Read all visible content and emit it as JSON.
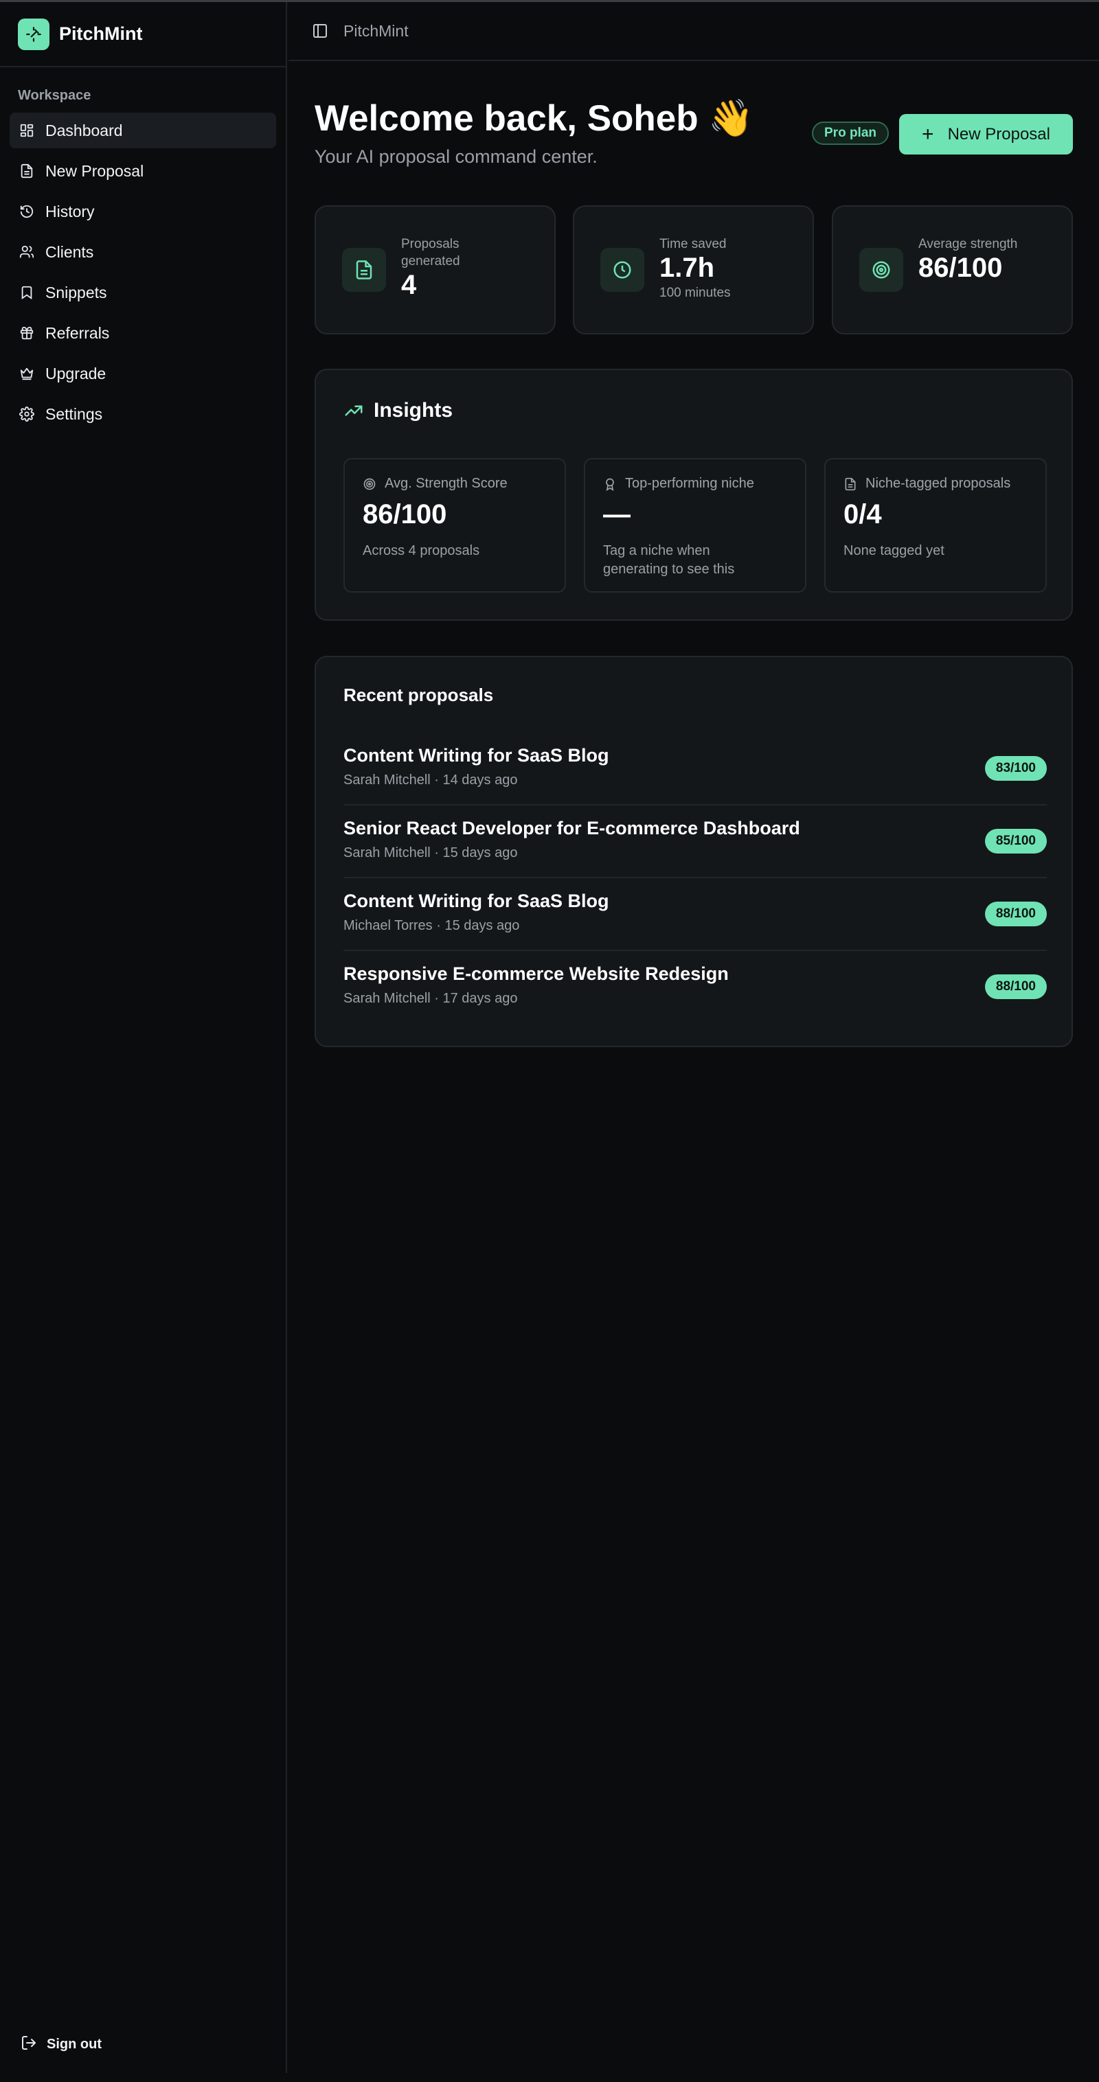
{
  "brand": {
    "name": "PitchMint"
  },
  "sidebar": {
    "section_label": "Workspace",
    "items": [
      {
        "label": "Dashboard",
        "icon": "dashboard-icon",
        "active": true
      },
      {
        "label": "New Proposal",
        "icon": "file-icon"
      },
      {
        "label": "History",
        "icon": "history-icon"
      },
      {
        "label": "Clients",
        "icon": "users-icon"
      },
      {
        "label": "Snippets",
        "icon": "bookmark-icon"
      },
      {
        "label": "Referrals",
        "icon": "gift-icon"
      },
      {
        "label": "Upgrade",
        "icon": "crown-icon"
      },
      {
        "label": "Settings",
        "icon": "gear-icon"
      }
    ],
    "sign_out": "Sign out"
  },
  "topbar": {
    "title": "PitchMint"
  },
  "header": {
    "welcome": "Welcome back, Soheb 👋",
    "subtitle": "Your AI proposal command center.",
    "plan_badge": "Pro plan",
    "new_proposal_button": "New Proposal"
  },
  "stats": [
    {
      "label": "Proposals generated",
      "value": "4",
      "sub": "",
      "icon": "document-icon"
    },
    {
      "label": "Time saved",
      "value": "1.7h",
      "sub": "100 minutes",
      "icon": "clock-icon"
    },
    {
      "label": "Average strength",
      "value": "86/100",
      "sub": "",
      "icon": "target-icon"
    }
  ],
  "insights": {
    "title": "Insights",
    "cards": [
      {
        "label": "Avg. Strength Score",
        "value": "86/100",
        "sub": "Across 4 proposals",
        "icon": "target-icon"
      },
      {
        "label": "Top-performing niche",
        "value": "—",
        "sub": "Tag a niche when generating to see this",
        "icon": "award-icon"
      },
      {
        "label": "Niche-tagged proposals",
        "value": "0/4",
        "sub": "None tagged yet",
        "icon": "document-icon"
      }
    ]
  },
  "recent": {
    "title": "Recent proposals",
    "items": [
      {
        "title": "Content Writing for SaaS Blog",
        "meta": "Sarah Mitchell · 14 days ago",
        "score": "83/100"
      },
      {
        "title": "Senior React Developer for E-commerce Dashboard",
        "meta": "Sarah Mitchell · 15 days ago",
        "score": "85/100"
      },
      {
        "title": "Content Writing for SaaS Blog",
        "meta": "Michael Torres · 15 days ago",
        "score": "88/100"
      },
      {
        "title": "Responsive E-commerce Website Redesign",
        "meta": "Sarah Mitchell · 17 days ago",
        "score": "88/100"
      }
    ]
  },
  "colors": {
    "accent": "#6fe3b4",
    "background": "#0b0c0e",
    "card": "#14171a"
  }
}
